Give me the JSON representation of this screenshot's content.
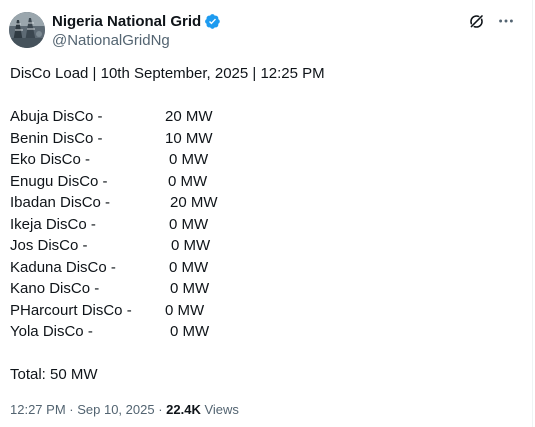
{
  "author": {
    "display_name": "Nigeria National Grid",
    "handle": "@NationalGridNg",
    "verified_icon": "verified-badge-icon",
    "avatar_icon": "avatar-image"
  },
  "actions": {
    "grok_icon": "grok-icon",
    "more_icon": "more-options-icon"
  },
  "post": {
    "heading": "DisCo Load | 10th September, 2025 | 12:25 PM",
    "rows": [
      {
        "label": "Abuja DisCo -",
        "value": "20 MW"
      },
      {
        "label": "Benin DisCo -",
        "value": "10 MW"
      },
      {
        "label": "Eko DisCo -",
        "value": "0 MW"
      },
      {
        "label": "Enugu DisCo -",
        "value": "0 MW"
      },
      {
        "label": "Ibadan DisCo -",
        "value": "20 MW"
      },
      {
        "label": "Ikeja DisCo -",
        "value": "0 MW"
      },
      {
        "label": "Jos DisCo -",
        "value": "0 MW"
      },
      {
        "label": "Kaduna DisCo -",
        "value": "0 MW"
      },
      {
        "label": "Kano DisCo -",
        "value": "0 MW"
      },
      {
        "label": "PHarcourt DisCo -",
        "value": "0 MW"
      },
      {
        "label": "Yola DisCo -",
        "value": "0 MW"
      }
    ],
    "total": "Total: 50 MW"
  },
  "meta": {
    "time": "12:27 PM",
    "separator": " · ",
    "date": "Sep 10, 2025",
    "views_count": "22.4K",
    "views_label": " Views"
  },
  "colors": {
    "text": "#0f1419",
    "secondary": "#536471",
    "verified": "#1d9bf0"
  }
}
